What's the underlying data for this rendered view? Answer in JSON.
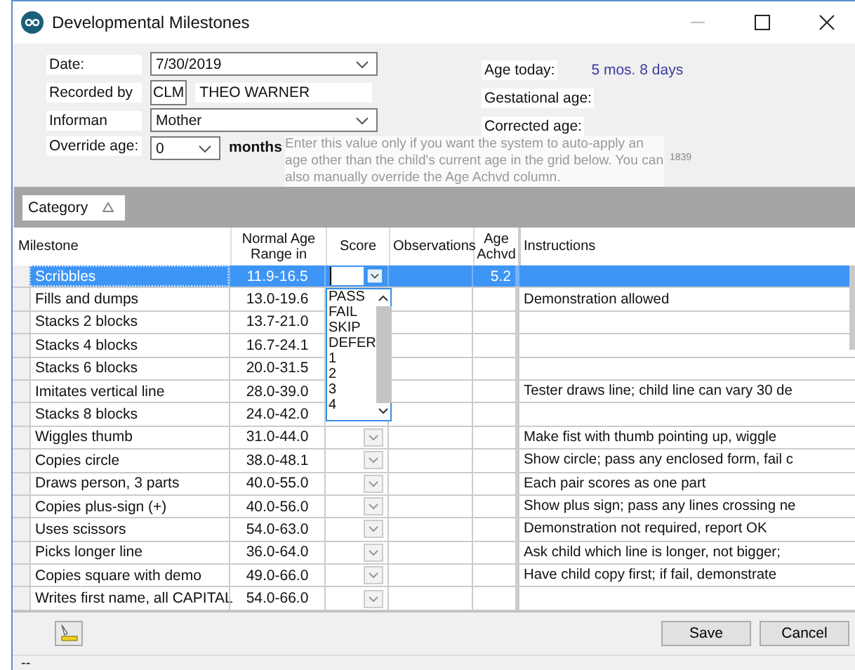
{
  "window": {
    "title": "Developmental Milestones"
  },
  "form": {
    "date": {
      "label": "Date:",
      "value": "7/30/2019"
    },
    "recorded_by": {
      "label": "Recorded by",
      "code": "CLM",
      "name": "THEO WARNER"
    },
    "informant": {
      "label": "Informan",
      "value": "Mother"
    },
    "override_age": {
      "label": "Override age:",
      "value": "0",
      "unit": "months",
      "hint": "Enter this value only if you want the system to auto-apply an age other than the child's current age in the grid below. You can also manually override the Age Achvd column.",
      "code": "1839"
    },
    "age_today": {
      "label": "Age today:",
      "value": "5 mos. 8 days"
    },
    "gestational_age": {
      "label": "Gestational age:"
    },
    "corrected_age": {
      "label": "Corrected age:"
    }
  },
  "group_by": {
    "label": "Category"
  },
  "table": {
    "columns": [
      "Milestone",
      "Normal Age Range in",
      "Score",
      "Observations",
      "Age Achvd",
      "Instructions"
    ],
    "rows": [
      {
        "milestone": "Scribbles",
        "range": "11.9-16.5",
        "age_achvd": "5.2",
        "selected": true
      },
      {
        "milestone": "Fills and dumps",
        "range": "13.0-19.6",
        "instructions": "Demonstration allowed",
        "selected": false
      },
      {
        "milestone": "Stacks 2 blocks",
        "range": "13.7-21.0",
        "selected": false
      },
      {
        "milestone": "Stacks 4 blocks",
        "range": "16.7-24.1",
        "selected": false
      },
      {
        "milestone": "Stacks 6 blocks",
        "range": "20.0-31.5",
        "selected": false
      },
      {
        "milestone": "Imitates vertical line",
        "range": "28.0-39.0",
        "instructions": "Tester draws line; child line can vary 30 de",
        "selected": false
      },
      {
        "milestone": "Stacks 8 blocks",
        "range": "24.0-42.0",
        "selected": false
      },
      {
        "milestone": "Wiggles thumb",
        "range": "31.0-44.0",
        "instructions": "Make fist with thumb pointing up, wiggle",
        "selected": false
      },
      {
        "milestone": "Copies circle",
        "range": "38.0-48.1",
        "instructions": "Show circle; pass any enclosed form, fail c",
        "selected": false
      },
      {
        "milestone": "Draws person, 3 parts",
        "range": "40.0-55.0",
        "instructions": "Each pair scores as one part",
        "selected": false
      },
      {
        "milestone": "Copies plus-sign (+)",
        "range": "40.0-56.0",
        "instructions": "Show plus sign; pass any lines crossing ne",
        "selected": false
      },
      {
        "milestone": "Uses scissors",
        "range": "54.0-63.0",
        "instructions": "Demonstration not required, report OK",
        "selected": false
      },
      {
        "milestone": "Picks longer line",
        "range": "36.0-64.0",
        "instructions": "Ask child which line is longer, not bigger;",
        "selected": false
      },
      {
        "milestone": "Copies square with demo",
        "range": "49.0-66.0",
        "instructions": "Have child copy first; if fail, demonstrate",
        "selected": false
      },
      {
        "milestone": "Writes first name, all CAPITAL",
        "range": "54.0-66.0",
        "selected": false
      }
    ]
  },
  "score_dropdown": {
    "options": [
      "PASS",
      "FAIL",
      "SKIP",
      "DEFER",
      "1",
      "2",
      "3",
      "4"
    ]
  },
  "buttons": [
    "Save",
    "Cancel"
  ],
  "status_bar": "--"
}
